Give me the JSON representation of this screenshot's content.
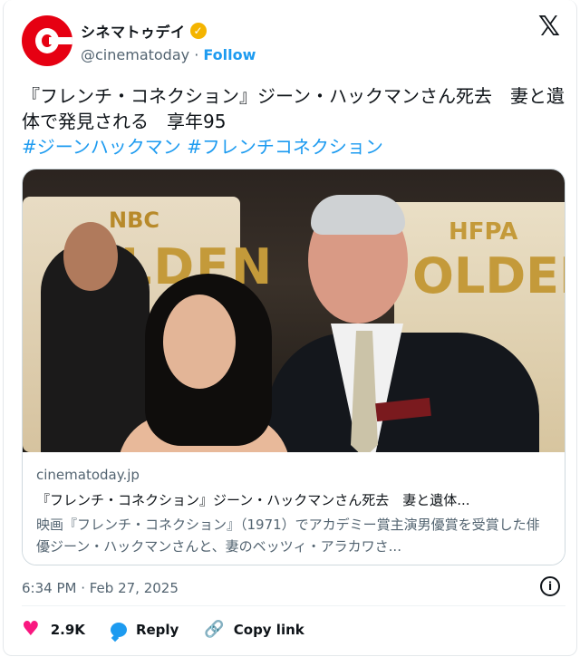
{
  "account": {
    "display_name": "シネマトゥデイ",
    "handle": "@cinematoday",
    "separator": " · ",
    "follow_label": "Follow",
    "verified_icon": "check-badge"
  },
  "tweet": {
    "text": "『フレンチ・コネクション』ジーン・ハックマンさん死去　妻と遺体で発見される　享年95",
    "hashtags": "#ジーンハックマン #フレンチコネクション",
    "timestamp": "6:34 PM · Feb 27, 2025"
  },
  "link_card": {
    "domain": "cinematoday.jp",
    "title": "『フレンチ・コネクション』ジーン・ハックマンさん死去　妻と遺体...",
    "description": "映画『フレンチ・コネクション』（1971）でアカデミー賞主演男優賞を受賞した俳優ジーン・ハックマンさんと、妻のベッツィ・アラカワさ...",
    "image_text": {
      "nbc": "NBC",
      "golden_left": "OLDEN",
      "hfpa": "HFPA",
      "golden_right": "OLDEN"
    }
  },
  "actions": {
    "likes": "2.9K",
    "reply_label": "Reply",
    "copy_link_label": "Copy link"
  },
  "colors": {
    "brand_red": "#e60012",
    "link_blue": "#1d9bf0",
    "heart_pink": "#f91880",
    "muted": "#536471"
  }
}
